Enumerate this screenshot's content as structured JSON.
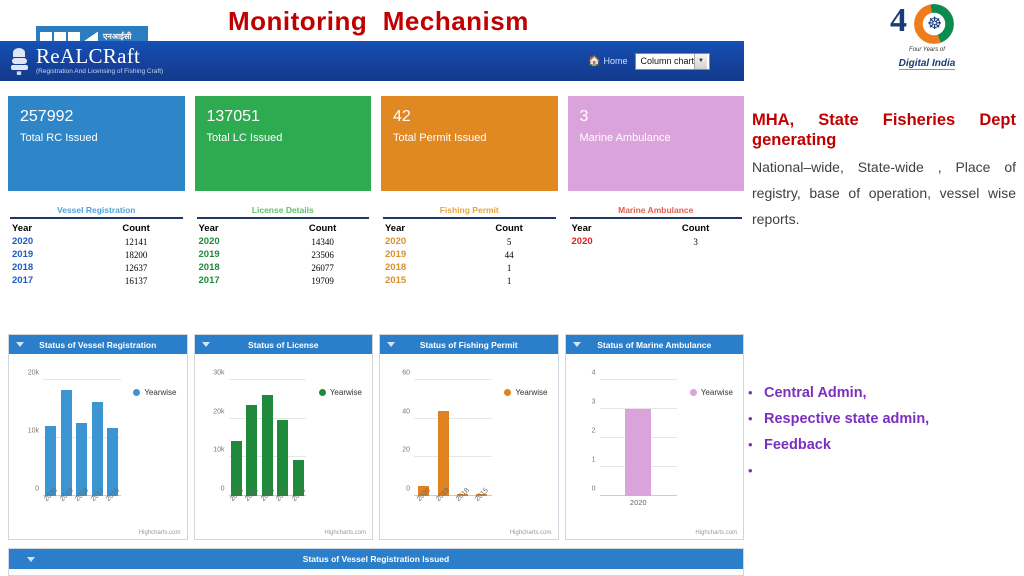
{
  "slide": {
    "title": "Monitoring  Mechanism"
  },
  "logos": {
    "nic": {
      "name": "nic-logo",
      "hindi_text": "एनआईसी"
    },
    "digital_india": {
      "four": "4",
      "caption_top": "Four Years of",
      "caption_main": "Digital India"
    }
  },
  "app_header": {
    "brand": "ReALCRaft",
    "brand_sub": "(Registration And Licensing of Fishing Craft)",
    "home_label": "Home",
    "home_icon": "home-icon",
    "chart_select_value": "Column chart",
    "chart_select_caret": "chevron-down-icon"
  },
  "kpis": [
    {
      "value": "257992",
      "label": "Total RC Issued",
      "color": "#2e86c8"
    },
    {
      "value": "137051",
      "label": "Total LC Issued",
      "color": "#2eab51"
    },
    {
      "value": "42",
      "label": "Total Permit Issued",
      "color": "#e08821"
    },
    {
      "value": "3",
      "label": "Marine Ambulance",
      "color": "#dba3db"
    }
  ],
  "tables": [
    {
      "title": "Vessel Registration",
      "title_color": "#4da3dd",
      "year_color": "#1f5bc4",
      "columns": [
        "Year",
        "Count"
      ],
      "rows": [
        [
          "2020",
          "12141"
        ],
        [
          "2019",
          "18200"
        ],
        [
          "2018",
          "12637"
        ],
        [
          "2017",
          "16137"
        ]
      ]
    },
    {
      "title": "License Details",
      "title_color": "#5fbf6f",
      "year_color": "#1f8a3b",
      "columns": [
        "Year",
        "Count"
      ],
      "rows": [
        [
          "2020",
          "14340"
        ],
        [
          "2019",
          "23506"
        ],
        [
          "2018",
          "26077"
        ],
        [
          "2017",
          "19709"
        ]
      ]
    },
    {
      "title": "Fishing Permit",
      "title_color": "#e8a23c",
      "year_color": "#d9912e",
      "columns": [
        "Year",
        "Count"
      ],
      "rows": [
        [
          "2020",
          "5"
        ],
        [
          "2019",
          "44"
        ],
        [
          "2018",
          "1"
        ],
        [
          "2015",
          "1"
        ]
      ]
    },
    {
      "title": "Marine Ambulance",
      "title_color": "#e0604f",
      "year_color": "#e02020",
      "columns": [
        "Year",
        "Count"
      ],
      "rows": [
        [
          "2020",
          "3"
        ]
      ]
    }
  ],
  "panels": [
    {
      "title": "Status of Vessel Registration",
      "legend": "Yearwise"
    },
    {
      "title": "Status of License",
      "legend": "Yearwise"
    },
    {
      "title": "Status of Fishing Permit",
      "legend": "Yearwise"
    },
    {
      "title": "Status of Marine Ambulance",
      "legend": "Yearwise"
    }
  ],
  "bottom_panel": {
    "title": "Status of Vessel Registration Issued"
  },
  "right_panel": {
    "heading": "MHA, State Fisheries Dept generating",
    "body": "National–wide, State-wide , Place of registry, base of operation, vessel wise reports."
  },
  "bullets": [
    "Central Admin,",
    "Respective state admin,",
    " Feedback",
    ""
  ],
  "credit": "Highcharts.com",
  "chart_data": [
    {
      "type": "bar",
      "title": "Status of Vessel Registration",
      "series": [
        {
          "name": "Yearwise",
          "values": [
            12141,
            18200,
            12637,
            16137,
            11800
          ]
        }
      ],
      "categories": [
        "2020",
        "2019",
        "2018",
        "2017",
        "2016"
      ],
      "ylim": [
        0,
        20000
      ],
      "yticks": [
        0,
        10000,
        20000
      ],
      "ytick_labels": [
        "0",
        "10k",
        "20k"
      ],
      "color": "#3b95d3",
      "xlabel": "",
      "ylabel": "",
      "grid": true,
      "legend_position": "right"
    },
    {
      "type": "bar",
      "title": "Status of License",
      "series": [
        {
          "name": "Yearwise",
          "values": [
            14340,
            23506,
            26077,
            19709,
            9400
          ]
        }
      ],
      "categories": [
        "2020",
        "2019",
        "2018",
        "2017",
        "2016"
      ],
      "ylim": [
        0,
        30000
      ],
      "yticks": [
        0,
        10000,
        20000,
        30000
      ],
      "ytick_labels": [
        "0",
        "10k",
        "20k",
        "30k"
      ],
      "color": "#1f8a3b",
      "xlabel": "",
      "ylabel": "",
      "grid": true,
      "legend_position": "right"
    },
    {
      "type": "bar",
      "title": "Status of Fishing Permit",
      "series": [
        {
          "name": "Yearwise",
          "values": [
            5,
            44,
            1,
            1
          ]
        }
      ],
      "categories": [
        "2020",
        "2019",
        "2018",
        "2015"
      ],
      "ylim": [
        0,
        60
      ],
      "yticks": [
        0,
        20,
        40,
        60
      ],
      "ytick_labels": [
        "0",
        "20",
        "40",
        "60"
      ],
      "color": "#e0821f",
      "xlabel": "",
      "ylabel": "",
      "grid": true,
      "legend_position": "right"
    },
    {
      "type": "bar",
      "title": "Status of Marine Ambulance",
      "series": [
        {
          "name": "Yearwise",
          "values": [
            3
          ]
        }
      ],
      "categories": [
        "2020"
      ],
      "ylim": [
        0,
        4
      ],
      "yticks": [
        0,
        1,
        2,
        3,
        4
      ],
      "ytick_labels": [
        "0",
        "1",
        "2",
        "3",
        "4"
      ],
      "color": "#dba3db",
      "xlabel": "",
      "ylabel": "",
      "grid": true,
      "legend_position": "right"
    }
  ]
}
